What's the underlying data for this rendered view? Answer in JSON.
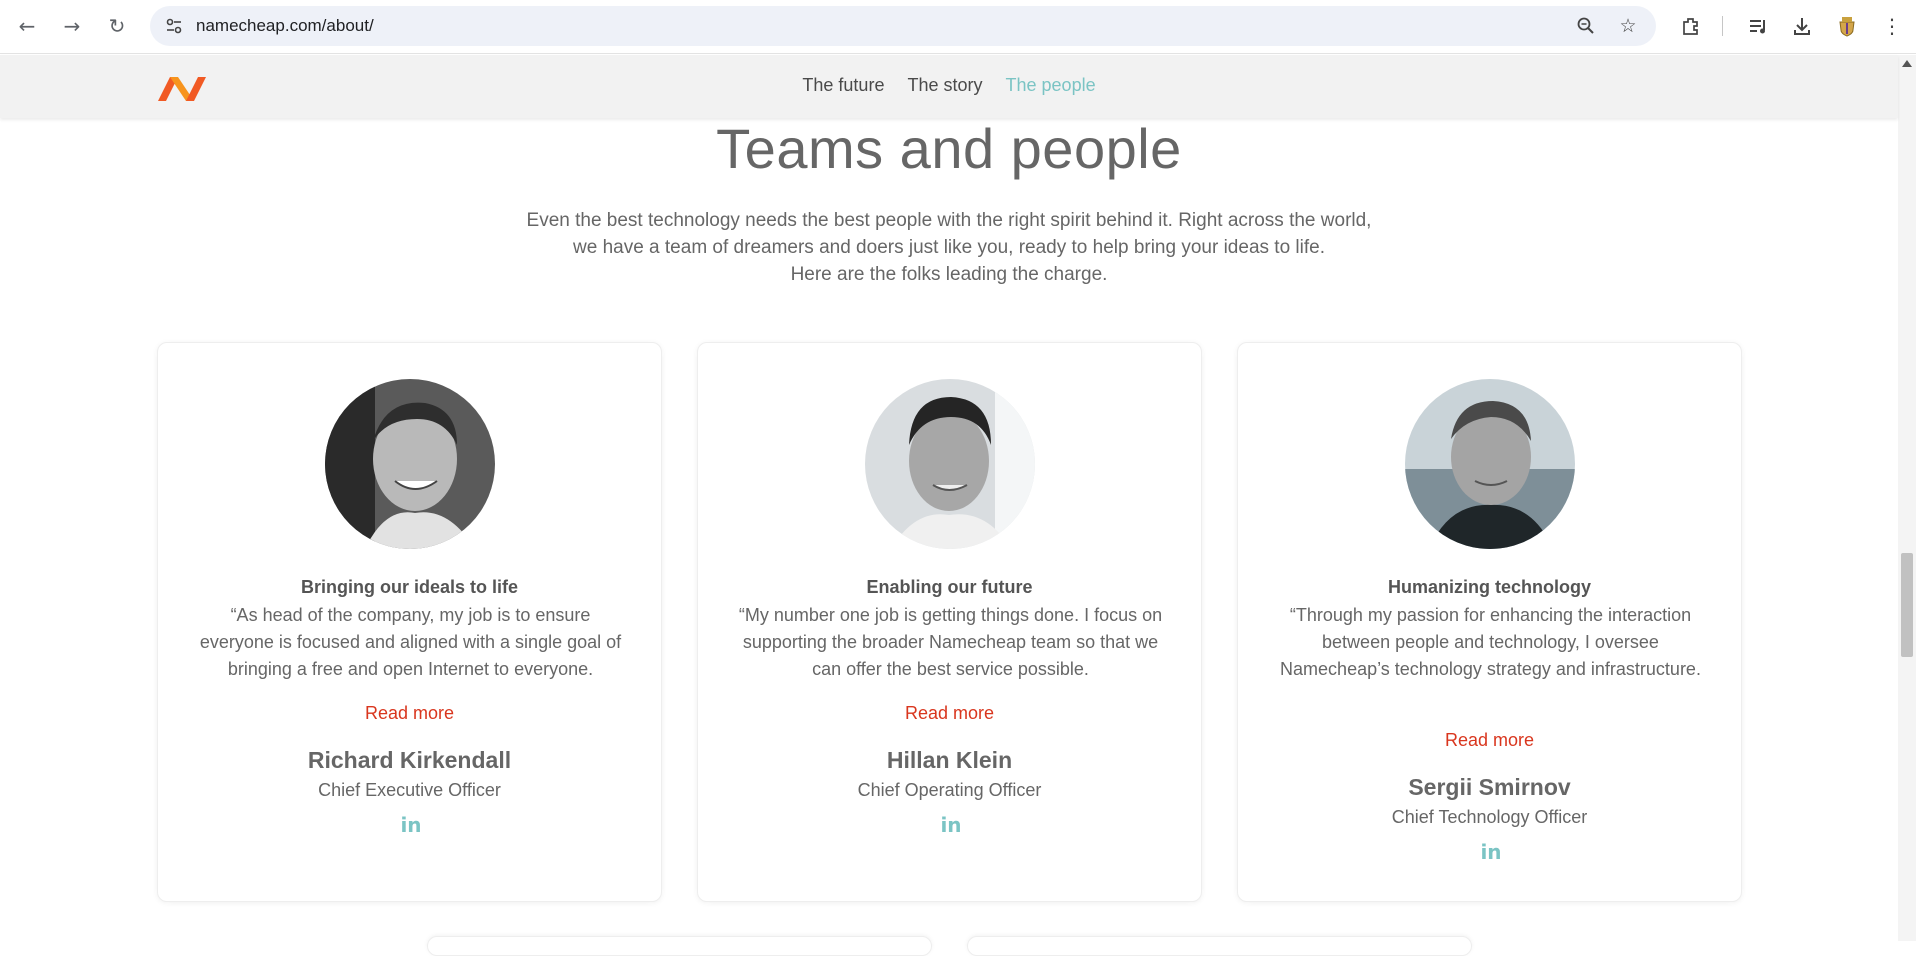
{
  "browser": {
    "url": "namecheap.com/about/"
  },
  "site_nav": {
    "items": [
      {
        "label": "The future"
      },
      {
        "label": "The story"
      },
      {
        "label": "The people"
      }
    ],
    "active": "The people"
  },
  "main": {
    "title": "Teams and people",
    "intro_lines": [
      "Even the best technology needs the best people with the right spirit behind it. Right across the world,",
      "we have a team of dreamers and doers just like you, ready to help bring your ideas to life.",
      "Here are the folks leading the charge."
    ]
  },
  "people": [
    {
      "heading": "Bringing our ideals to life",
      "quote": "“As head of the company, my job is to ensure everyone is focused and aligned with a single goal of bringing a free and open Internet to everyone.",
      "read_more": "Read more",
      "name": "Richard Kirkendall",
      "role": "Chief Executive Officer",
      "linkedin": "in"
    },
    {
      "heading": "Enabling our future",
      "quote": "“My number one job is getting things done. I focus on supporting the broader Namecheap team so that we can offer the best service possible.",
      "read_more": "Read more",
      "name": "Hillan Klein",
      "role": "Chief Operating Officer",
      "linkedin": "in"
    },
    {
      "heading": "Humanizing technology",
      "quote": "“Through my passion for enhancing the interaction between people and technology, I oversee Namecheap’s technology strategy and infrastructure.",
      "read_more": "Read more",
      "name": "Sergii Smirnov",
      "role": "Chief Technology Officer",
      "linkedin": "in"
    }
  ],
  "colors": {
    "accent_teal": "#7bc4c4",
    "read_more_red": "#d9361e",
    "brand_orange": "#f15a24"
  }
}
